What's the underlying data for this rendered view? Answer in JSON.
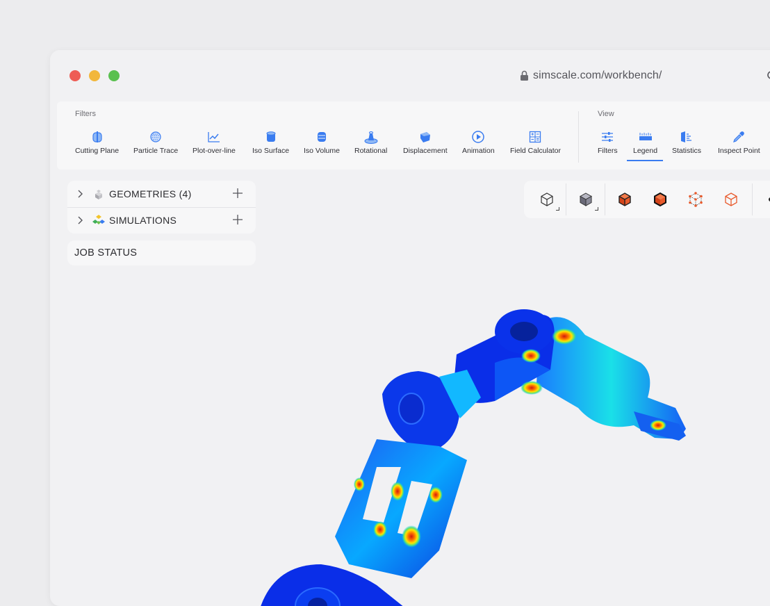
{
  "browser": {
    "url": "simscale.com/workbench/",
    "lock_icon": "lock-icon",
    "reload_icon": "reload-icon"
  },
  "toolbar": {
    "filters_label": "Filters",
    "view_label": "View",
    "filters": [
      {
        "label": "Cutting Plane",
        "icon": "cutting-plane-icon"
      },
      {
        "label": "Particle Trace",
        "icon": "particle-trace-icon"
      },
      {
        "label": "Plot-over-line",
        "icon": "plot-over-line-icon"
      },
      {
        "label": "Iso Surface",
        "icon": "iso-surface-icon"
      },
      {
        "label": "Iso Volume",
        "icon": "iso-volume-icon"
      },
      {
        "label": "Rotational",
        "icon": "rotational-icon"
      },
      {
        "label": "Displacement",
        "icon": "displacement-icon"
      },
      {
        "label": "Animation",
        "icon": "animation-icon"
      },
      {
        "label": "Field Calculator",
        "icon": "field-calculator-icon"
      }
    ],
    "view": [
      {
        "label": "Filters",
        "icon": "sliders-icon"
      },
      {
        "label": "Legend",
        "icon": "legend-icon",
        "active": true
      },
      {
        "label": "Statistics",
        "icon": "statistics-icon"
      },
      {
        "label": "Inspect Point",
        "icon": "eyedropper-icon"
      }
    ],
    "accent_color": "#3a7cf0",
    "icon_color": "#3a7cf0"
  },
  "tree": {
    "items": [
      {
        "label": "GEOMETRIES",
        "count": "(4)"
      },
      {
        "label": "SIMULATIONS"
      }
    ]
  },
  "job_status": {
    "label": "JOB STATUS"
  },
  "view_controls": [
    {
      "name": "view-cube-outline"
    },
    {
      "name": "view-cube-solid"
    },
    {
      "name": "view-cube-edges-highlight"
    },
    {
      "name": "view-cube-edges-dark"
    },
    {
      "name": "view-cube-points"
    },
    {
      "name": "view-cube-wireframe"
    }
  ],
  "colors": {
    "window_bg": "#f1f1f3",
    "panel_bg": "#f7f7f8",
    "cube_orange": "#f0582a"
  }
}
